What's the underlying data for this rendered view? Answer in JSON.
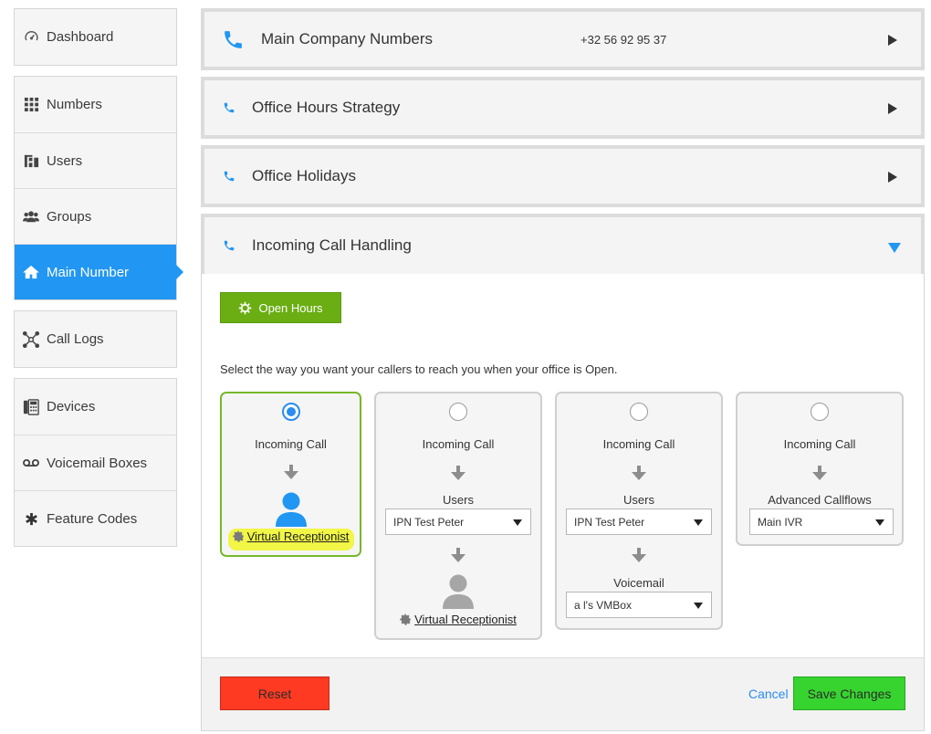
{
  "sidebar": {
    "items": [
      {
        "label": "Dashboard",
        "icon": "gauge-icon"
      },
      {
        "label": "Numbers",
        "icon": "grid-icon"
      },
      {
        "label": "Users",
        "icon": "users-hierarchy-icon"
      },
      {
        "label": "Groups",
        "icon": "group-icon"
      },
      {
        "label": "Main Number",
        "icon": "home-icon",
        "active": true
      },
      {
        "label": "Call Logs",
        "icon": "network-icon"
      },
      {
        "label": "Devices",
        "icon": "desk-phone-icon"
      },
      {
        "label": "Voicemail Boxes",
        "icon": "voicemail-icon"
      },
      {
        "label": "Feature Codes",
        "icon": "asterisk-icon"
      }
    ]
  },
  "sections": {
    "main_company_numbers": {
      "title": "Main Company Numbers",
      "number": "+32 56 92 95 37"
    },
    "office_hours_strategy": {
      "title": "Office Hours Strategy"
    },
    "office_holidays": {
      "title": "Office Holidays"
    },
    "incoming_call_handling": {
      "title": "Incoming Call Handling"
    }
  },
  "incoming": {
    "open_hours_button": "Open Hours",
    "instructions": "Select the way you want your callers to reach you when your office is Open.",
    "options": [
      {
        "label": "Incoming Call",
        "selected": true,
        "link": "Virtual Receptionist"
      },
      {
        "label": "Incoming Call",
        "step_label": "Users",
        "select_value": "IPN Test Peter",
        "link": "Virtual Receptionist"
      },
      {
        "label": "Incoming Call",
        "step_label": "Users",
        "select_value": "IPN Test Peter",
        "step2_label": "Voicemail",
        "select2_value": "a l's VMBox"
      },
      {
        "label": "Incoming Call",
        "step_label": "Advanced Callflows",
        "select_value": "Main IVR"
      }
    ]
  },
  "footer": {
    "reset": "Reset",
    "cancel": "Cancel",
    "save": "Save Changes"
  },
  "colors": {
    "accent": "#2196f3",
    "open_hours": "#6aae13",
    "reset": "#ff3a22",
    "save": "#37d42f",
    "highlight": "#f0f53d"
  }
}
